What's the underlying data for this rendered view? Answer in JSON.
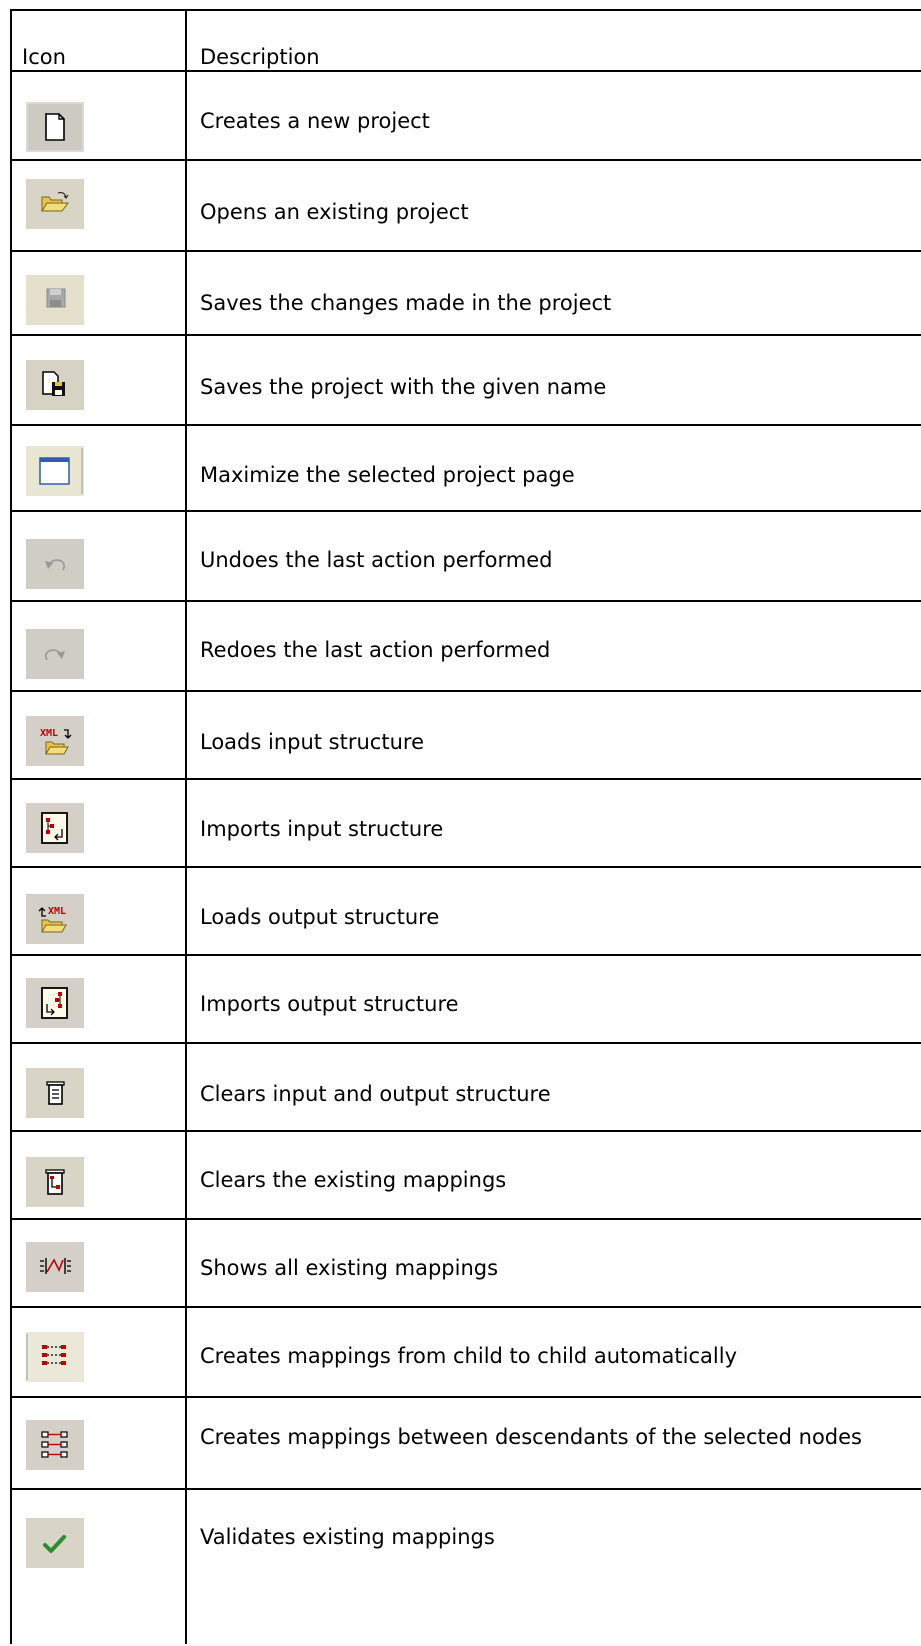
{
  "header": {
    "icon_label": "Icon",
    "description_label": "Description"
  },
  "rows": [
    {
      "icon": "new-project-icon",
      "description": "Creates a new project"
    },
    {
      "icon": "open-folder-icon",
      "description": "Opens an existing project"
    },
    {
      "icon": "save-icon",
      "description": "Saves the changes made in the project"
    },
    {
      "icon": "save-as-icon",
      "description": "Saves the project with the given name"
    },
    {
      "icon": "maximize-icon",
      "description": "Maximize the selected project page"
    },
    {
      "icon": "undo-icon",
      "description": "Undoes the last action performed"
    },
    {
      "icon": "redo-icon",
      "description": "Redoes the last action performed"
    },
    {
      "icon": "load-input-xml-icon",
      "description": "Loads input structure"
    },
    {
      "icon": "import-input-icon",
      "description": "Imports input structure"
    },
    {
      "icon": "load-output-xml-icon",
      "description": "Loads output structure"
    },
    {
      "icon": "import-output-icon",
      "description": "Imports output structure"
    },
    {
      "icon": "clear-structure-icon",
      "description": "Clears input and output structure"
    },
    {
      "icon": "clear-mappings-icon",
      "description": "Clears the existing mappings"
    },
    {
      "icon": "show-mappings-icon",
      "description": "Shows all existing mappings"
    },
    {
      "icon": "child-mappings-icon",
      "description": "Creates mappings from child to child automatically"
    },
    {
      "icon": "descendant-mappings-icon",
      "description": "Creates mappings between descendants of the selected nodes"
    },
    {
      "icon": "validate-icon",
      "description": "Validates existing mappings"
    }
  ]
}
